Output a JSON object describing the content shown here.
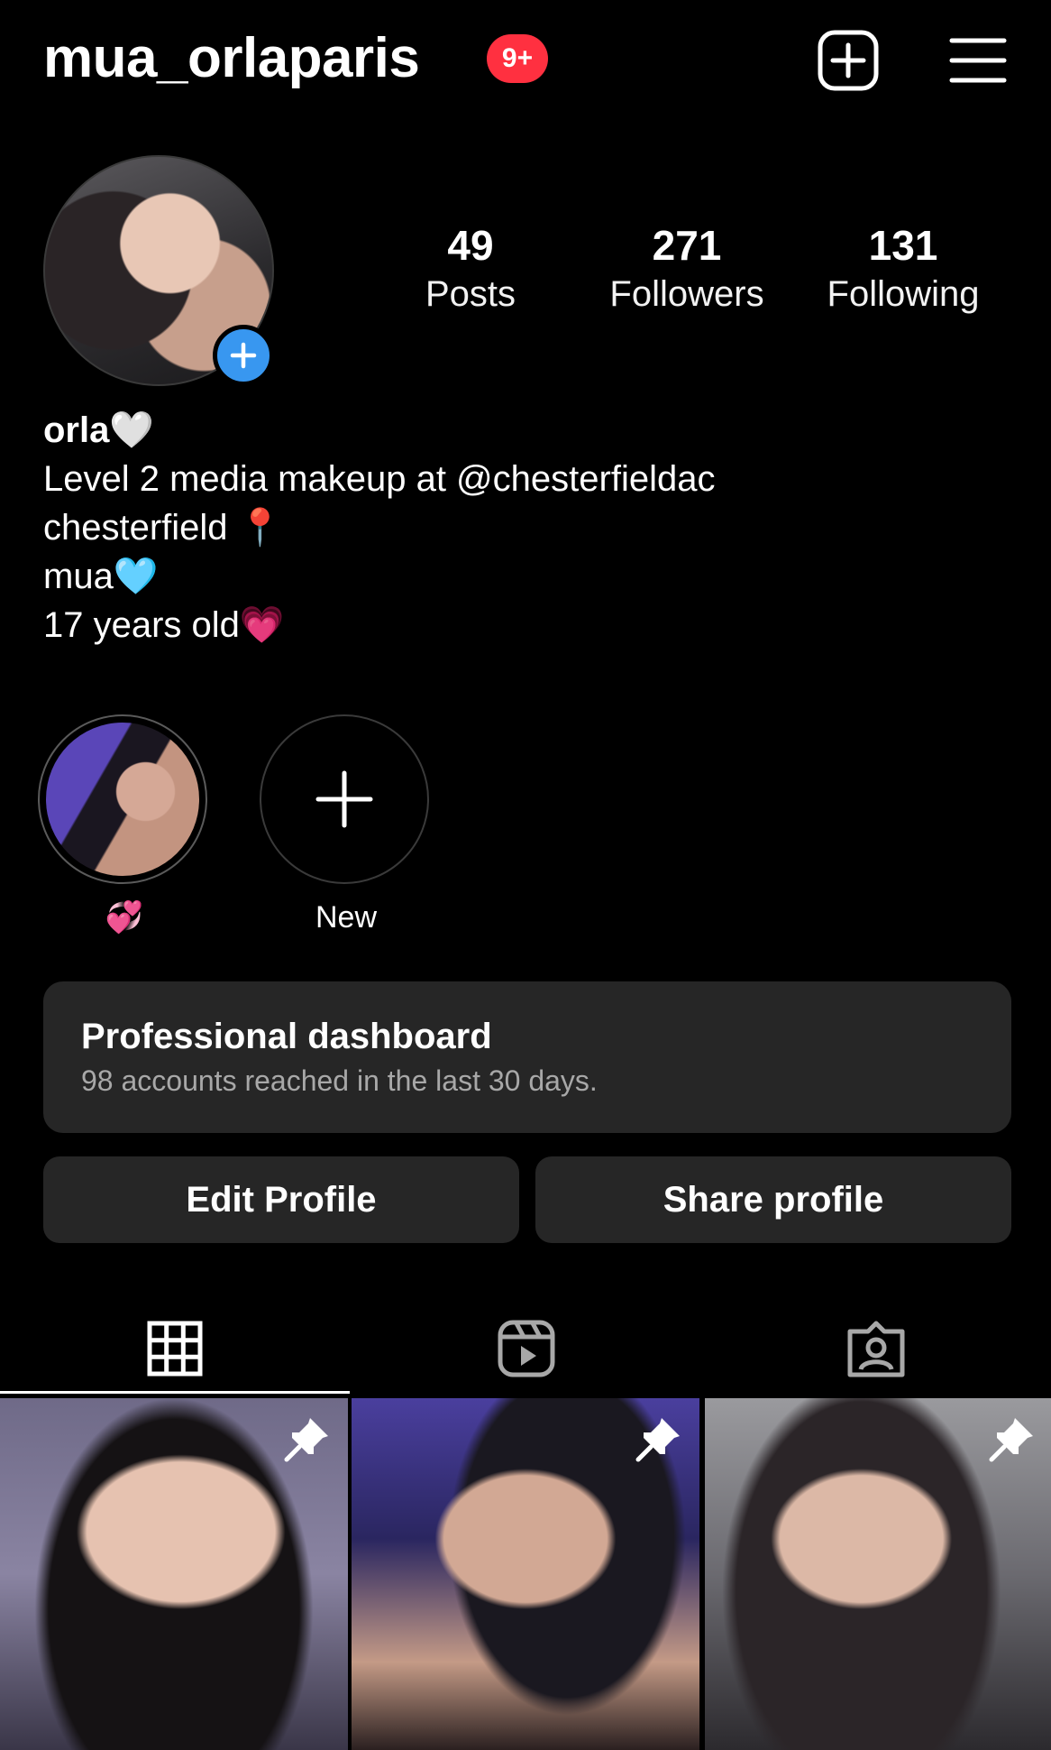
{
  "header": {
    "username": "mua_orlaparis",
    "notification_badge": "9+",
    "add_icon": "plus-square-icon",
    "menu_icon": "hamburger-menu-icon"
  },
  "stats": [
    {
      "value": "49",
      "label": "Posts"
    },
    {
      "value": "271",
      "label": "Followers"
    },
    {
      "value": "131",
      "label": "Following"
    }
  ],
  "bio": {
    "name": "orla🤍",
    "lines": [
      "Level 2 media makeup at @chesterfieldac",
      "chesterfield 📍",
      "mua🩵",
      "17 years old💗"
    ]
  },
  "highlights": [
    {
      "label": "💞"
    },
    {
      "label": "New"
    }
  ],
  "dashboard": {
    "title": "Professional dashboard",
    "subtitle": "98 accounts reached in the last 30 days."
  },
  "actions": {
    "edit": "Edit Profile",
    "share": "Share profile"
  },
  "tabs": [
    "grid-icon",
    "reels-icon",
    "tagged-icon"
  ],
  "colors": {
    "accent": "#3897f0",
    "badge": "#ff3040",
    "surface": "#262626"
  }
}
